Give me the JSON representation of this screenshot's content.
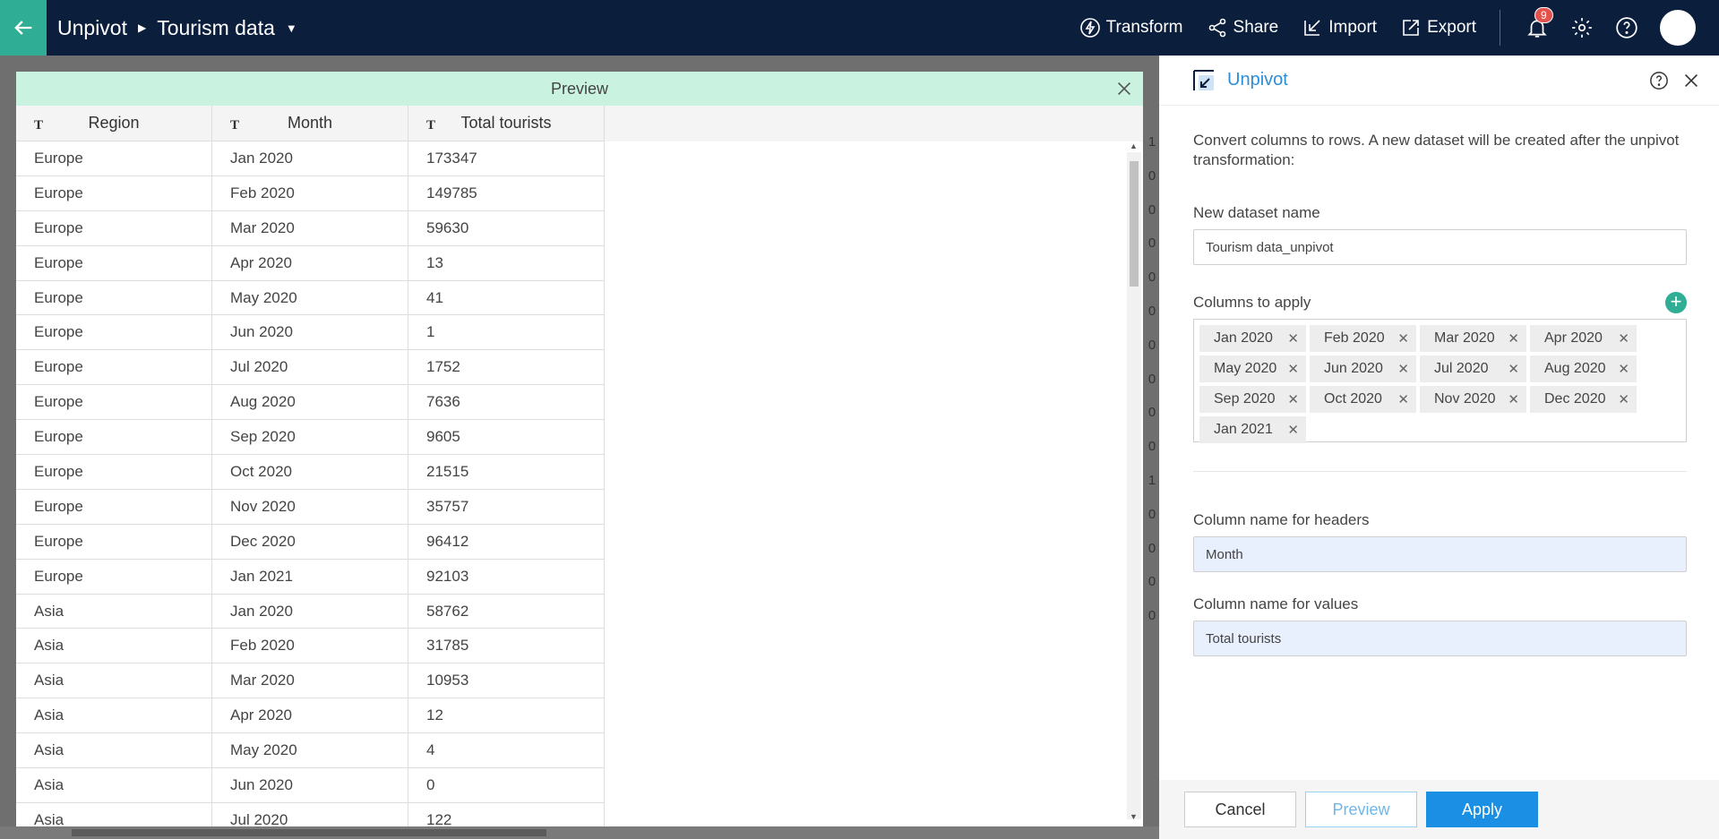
{
  "topbar": {
    "crumbs": [
      "Unpivot",
      "Tourism data"
    ],
    "actions": [
      {
        "label": "Transform",
        "icon": "transform-icon"
      },
      {
        "label": "Share",
        "icon": "share-icon"
      },
      {
        "label": "Import",
        "icon": "import-icon"
      },
      {
        "label": "Export",
        "icon": "export-icon"
      }
    ],
    "notification_count": "9"
  },
  "background": {
    "row_indicators": [
      "1",
      "0",
      "0",
      "0",
      "0",
      "0",
      "0",
      "0",
      "0",
      "0",
      "1",
      "0",
      "0",
      "0",
      "0"
    ]
  },
  "preview": {
    "title": "Preview",
    "columns": [
      {
        "type": "T",
        "label": "Region"
      },
      {
        "type": "T",
        "label": "Month"
      },
      {
        "type": "T",
        "label": "Total tourists"
      }
    ],
    "rows": [
      [
        "Europe",
        "Jan 2020",
        "173347"
      ],
      [
        "Europe",
        "Feb 2020",
        "149785"
      ],
      [
        "Europe",
        "Mar 2020",
        "59630"
      ],
      [
        "Europe",
        "Apr 2020",
        "13"
      ],
      [
        "Europe",
        "May 2020",
        "41"
      ],
      [
        "Europe",
        "Jun 2020",
        "1"
      ],
      [
        "Europe",
        "Jul 2020",
        "1752"
      ],
      [
        "Europe",
        "Aug 2020",
        "7636"
      ],
      [
        "Europe",
        "Sep 2020",
        "9605"
      ],
      [
        "Europe",
        "Oct 2020",
        "21515"
      ],
      [
        "Europe",
        "Nov 2020",
        "35757"
      ],
      [
        "Europe",
        "Dec 2020",
        "96412"
      ],
      [
        "Europe",
        "Jan 2021",
        "92103"
      ],
      [
        "Asia",
        "Jan 2020",
        "58762"
      ],
      [
        "Asia",
        "Feb 2020",
        "31785"
      ],
      [
        "Asia",
        "Mar 2020",
        "10953"
      ],
      [
        "Asia",
        "Apr 2020",
        "12"
      ],
      [
        "Asia",
        "May 2020",
        "4"
      ],
      [
        "Asia",
        "Jun 2020",
        "0"
      ],
      [
        "Asia",
        "Jul 2020",
        "122"
      ]
    ]
  },
  "panel": {
    "title": "Unpivot",
    "description": "Convert columns to rows. A new dataset will be created after the unpivot transformation:",
    "dataset_name_label": "New dataset name",
    "dataset_name_value": "Tourism data_unpivot",
    "columns_label": "Columns to apply",
    "chips": [
      "Jan 2020",
      "Feb 2020",
      "Mar 2020",
      "Apr 2020",
      "May 2020",
      "Jun 2020",
      "Jul 2020",
      "Aug 2020",
      "Sep 2020",
      "Oct 2020",
      "Nov 2020",
      "Dec 2020",
      "Jan 2021"
    ],
    "headers_label": "Column name for headers",
    "headers_value": "Month",
    "values_label": "Column name for values",
    "values_value": "Total tourists",
    "cancel": "Cancel",
    "preview": "Preview",
    "apply": "Apply"
  },
  "colors": {
    "topbar": "#0b1f3d",
    "accent_green": "#2fae95",
    "preview_header": "#c9f2e1",
    "link_blue": "#2a8fd8",
    "apply_blue": "#1a8fe3"
  }
}
